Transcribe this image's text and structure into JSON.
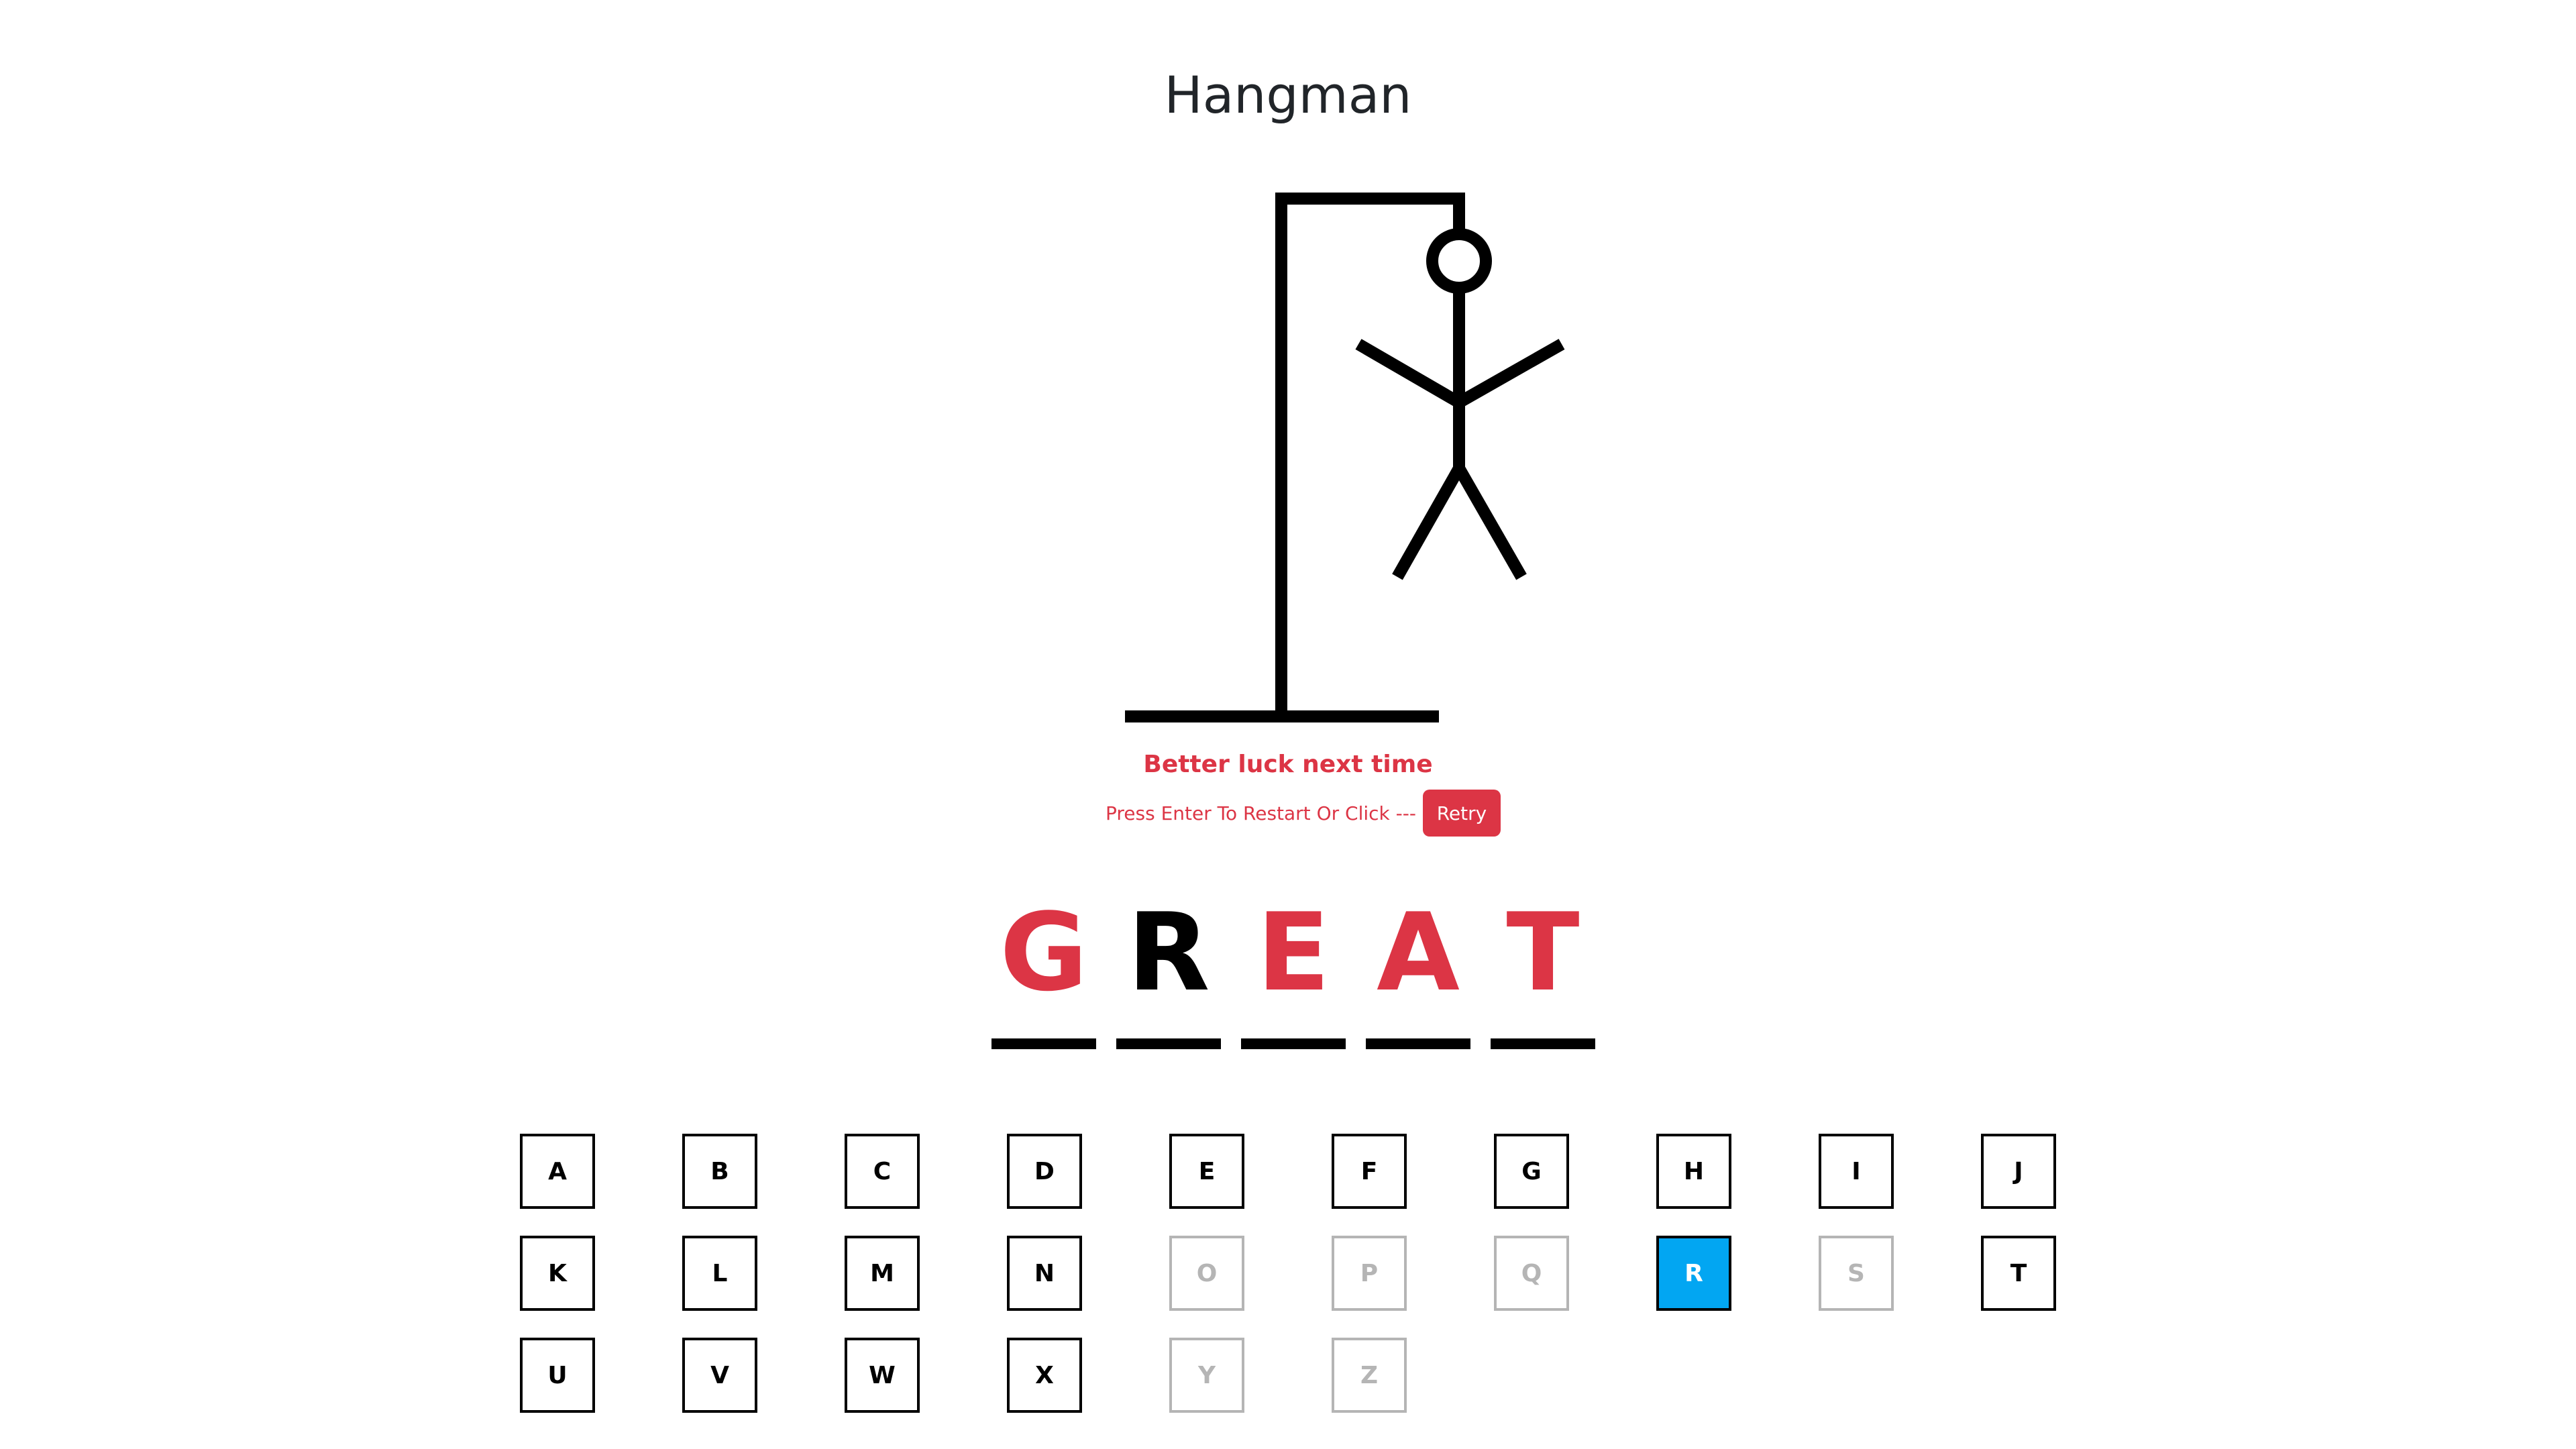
{
  "title": "Hangman",
  "status": {
    "message": "Better luck next time",
    "restart_hint": "Press Enter To Restart Or Click ---",
    "retry_label": "Retry"
  },
  "colors": {
    "missed_letter": "#dc3545",
    "found_letter": "#000000",
    "selected_key": "#02a6f2",
    "disabled_key": "#b5b5b5"
  },
  "word": {
    "letters": [
      {
        "char": "G",
        "state": "missed"
      },
      {
        "char": "R",
        "state": "found"
      },
      {
        "char": "E",
        "state": "missed"
      },
      {
        "char": "A",
        "state": "missed"
      },
      {
        "char": "T",
        "state": "missed"
      }
    ]
  },
  "keyboard": {
    "keys": [
      {
        "label": "A",
        "state": "available"
      },
      {
        "label": "B",
        "state": "available"
      },
      {
        "label": "C",
        "state": "available"
      },
      {
        "label": "D",
        "state": "available"
      },
      {
        "label": "E",
        "state": "available"
      },
      {
        "label": "F",
        "state": "available"
      },
      {
        "label": "G",
        "state": "available"
      },
      {
        "label": "H",
        "state": "available"
      },
      {
        "label": "I",
        "state": "available"
      },
      {
        "label": "J",
        "state": "available"
      },
      {
        "label": "K",
        "state": "available"
      },
      {
        "label": "L",
        "state": "available"
      },
      {
        "label": "M",
        "state": "available"
      },
      {
        "label": "N",
        "state": "available"
      },
      {
        "label": "O",
        "state": "disabled"
      },
      {
        "label": "P",
        "state": "disabled"
      },
      {
        "label": "Q",
        "state": "disabled"
      },
      {
        "label": "R",
        "state": "selected"
      },
      {
        "label": "S",
        "state": "disabled"
      },
      {
        "label": "T",
        "state": "available"
      },
      {
        "label": "U",
        "state": "available"
      },
      {
        "label": "V",
        "state": "available"
      },
      {
        "label": "W",
        "state": "available"
      },
      {
        "label": "X",
        "state": "available"
      },
      {
        "label": "Y",
        "state": "disabled"
      },
      {
        "label": "Z",
        "state": "disabled"
      }
    ]
  }
}
